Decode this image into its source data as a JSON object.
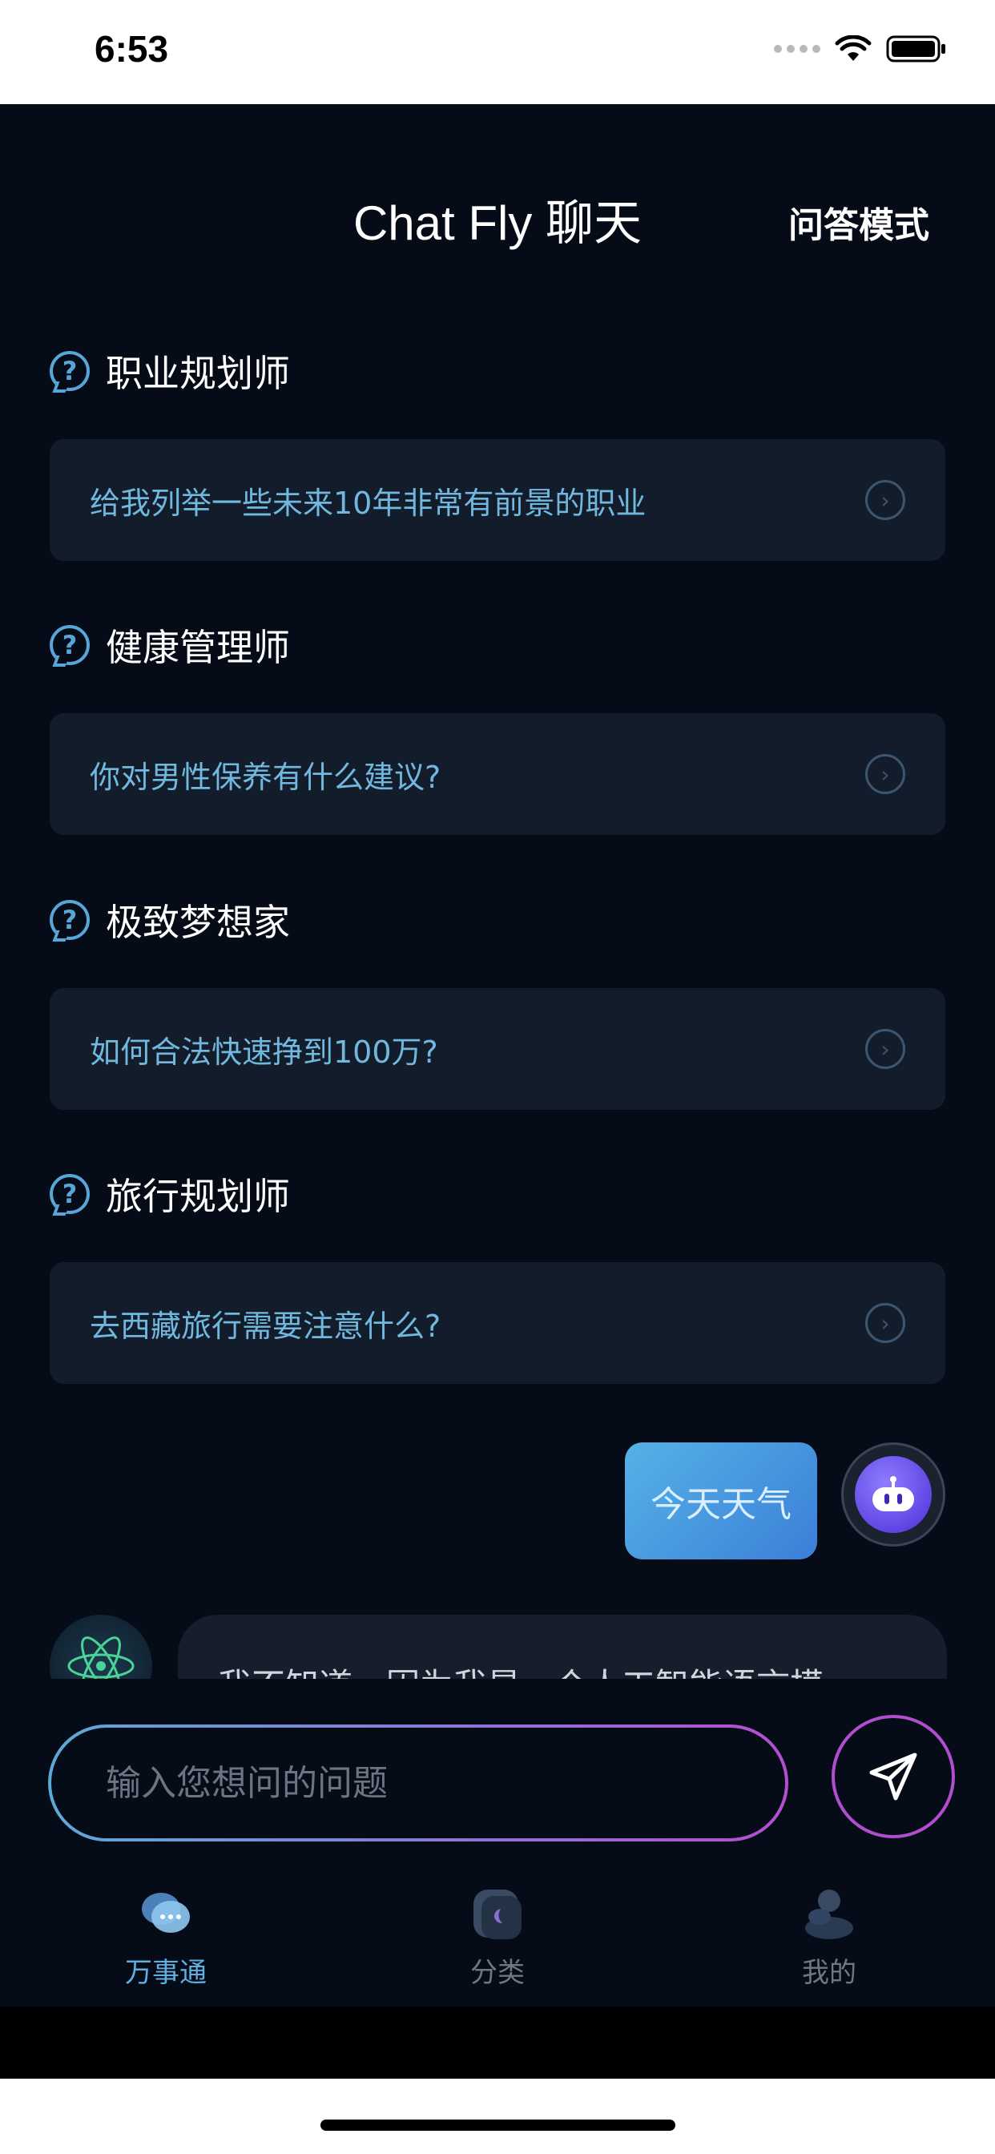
{
  "status_bar": {
    "time": "6:53"
  },
  "nav": {
    "title": "Chat Fly 聊天",
    "mode": "问答模式"
  },
  "sections": [
    {
      "title": "职业规划师",
      "question": "给我列举一些未来10年非常有前景的职业"
    },
    {
      "title": "健康管理师",
      "question": "你对男性保养有什么建议?"
    },
    {
      "title": "极致梦想家",
      "question": "如何合法快速挣到100万?"
    },
    {
      "title": "旅行规划师",
      "question": "去西藏旅行需要注意什么?"
    }
  ],
  "chat": {
    "user_message": "今天天气",
    "ai_message": "我不知道，因为我是一个人工智能语言模"
  },
  "input": {
    "placeholder": "输入您想问的问题"
  },
  "tabs": [
    {
      "label": "万事通",
      "icon": "chat-bubble-icon"
    },
    {
      "label": "分类",
      "icon": "category-icon"
    },
    {
      "label": "我的",
      "icon": "profile-icon"
    }
  ],
  "colors": {
    "background": "#050b17",
    "card": "#131c2b",
    "accent": "#5fb0e0",
    "gradient_end": "#b44ecf"
  }
}
